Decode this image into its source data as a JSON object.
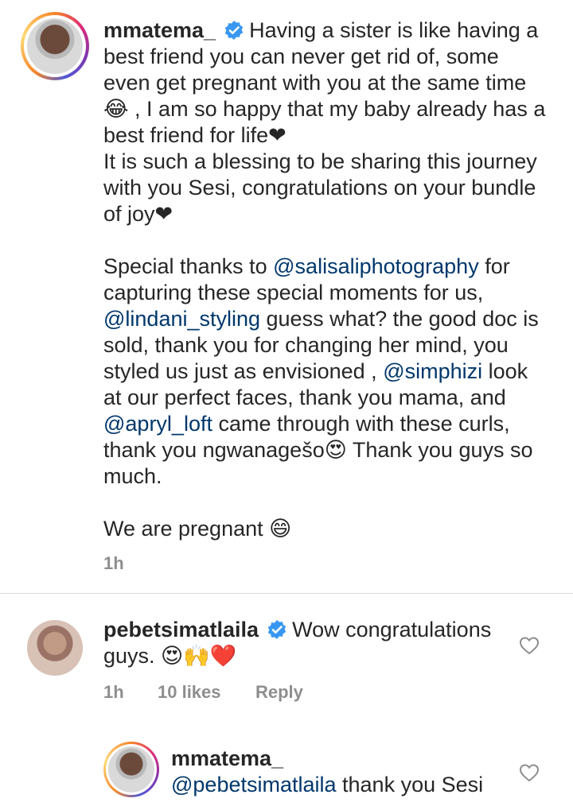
{
  "post": {
    "username": "mmatema_",
    "caption_p1": "Having a sister is like having a best friend you can never get rid of, some even get pregnant with you at the same time😂 , I am so happy that my baby already has a best friend for life❤",
    "caption_p2": "It is such a blessing to be sharing this journey with you Sesi, congratulations on your bundle of joy❤",
    "p3_a": "Special thanks to ",
    "mention_1": "@salisaliphotography",
    "p3_b": " for capturing these special moments for us, ",
    "mention_2": "@lindani_styling",
    "p3_c": " guess what? the good doc is sold, thank you for changing her mind, you styled us just as envisioned , ",
    "mention_3": "@simphizi",
    "p3_d": " look at our perfect faces, thank you mama, and ",
    "mention_4": "@apryl_loft",
    "p3_e": " came through with these curls, thank you ngwanagešo😍 Thank you guys so much.",
    "caption_p4": "We are pregnant 😄",
    "time": "1h"
  },
  "comment": {
    "username": "pebetsimatlaila",
    "text": "Wow congratulations guys. 😍🙌❤️",
    "time": "1h",
    "likes": "10 likes",
    "reply_label": "Reply"
  },
  "reply": {
    "username": "mmatema_",
    "mention": "@pebetsimatlaila",
    "text": " thank you Sesi"
  },
  "colors": {
    "text": "#262626",
    "mention": "#00376b",
    "meta": "#8e8e8e",
    "verified": "#3897f0"
  }
}
